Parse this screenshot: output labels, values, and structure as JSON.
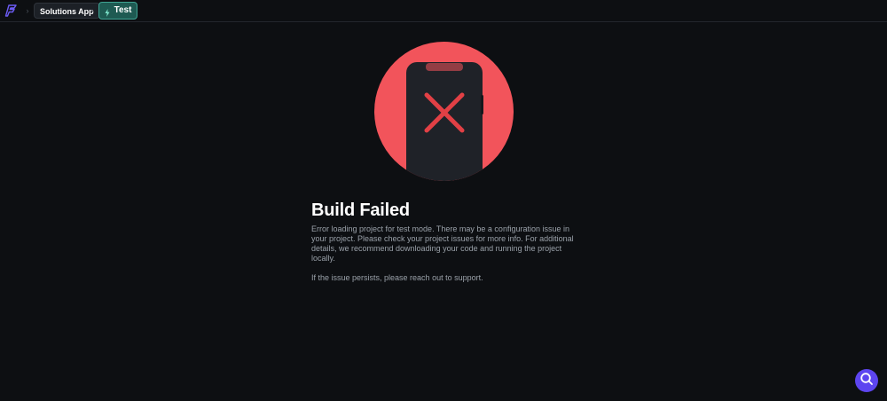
{
  "breadcrumb": {
    "project_name": "Solutions App",
    "mode_label": "Test"
  },
  "build_status": {
    "title": "Build Failed",
    "message": "Error loading project for test mode. There may be a configuration issue in your project. Please check your project issues for more info. For additional details, we recommend downloading your code and running the project locally.",
    "support_note": "If the issue persists, please reach out to support."
  },
  "icons": {
    "app_logo": "flutterflow-logo-icon",
    "separator": "chevron-right-icon",
    "mode": "lightning-bolt-icon",
    "illustration": "phone-error-x-icon",
    "help": "search-help-icon"
  },
  "colors": {
    "background": "#0d0f12",
    "accent_mode": "#1e5a52",
    "error": "#f2545b",
    "help_button": "#5d45f0"
  }
}
